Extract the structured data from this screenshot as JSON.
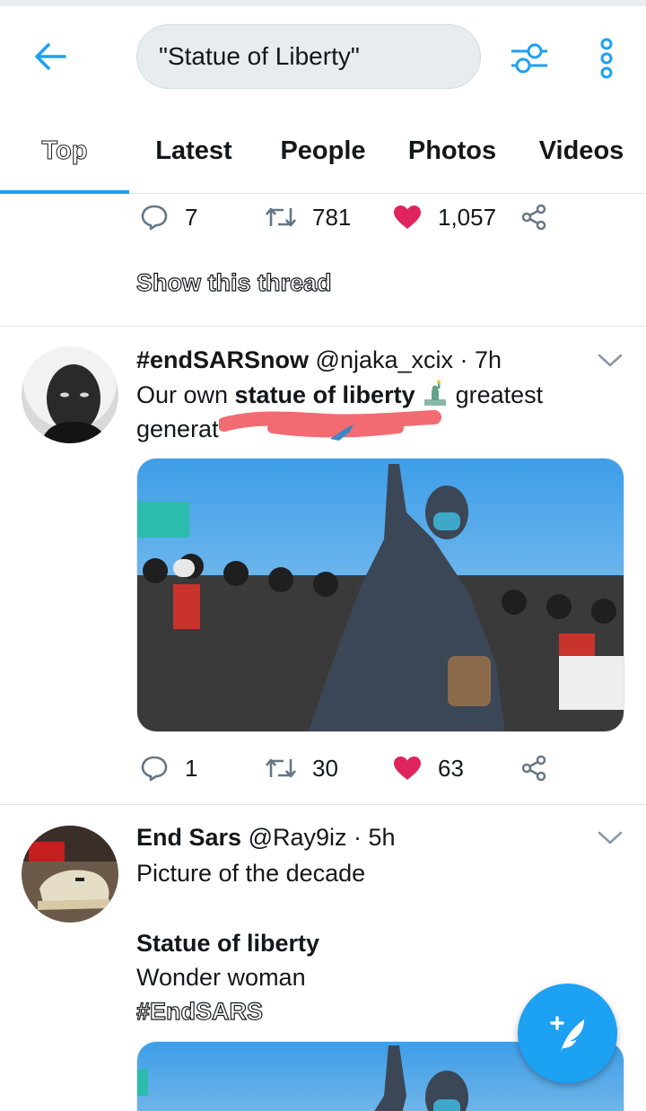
{
  "header": {
    "search_value": "\"Statue of Liberty\"",
    "back_icon": "arrow-left-icon",
    "filter_icon": "sliders-icon",
    "more_icon": "more-vertical-icon",
    "accent": "#1da1f2"
  },
  "tabs": [
    {
      "label": "Top"
    },
    {
      "label": "Latest"
    },
    {
      "label": "People"
    },
    {
      "label": "Photos"
    },
    {
      "label": "Videos"
    }
  ],
  "prev_tweet": {
    "replies": "7",
    "retweets": "781",
    "likes": "1,057",
    "show_thread": "Show this thread"
  },
  "tweet1": {
    "name": "#endSARSnow",
    "handle": "@njaka_xcix",
    "time": "· 7h",
    "text_plain": "Our own ",
    "text_bold": "statue of liberty",
    "text_after": " greatest",
    "text_line2": "generat",
    "replies": "1",
    "retweets": "30",
    "likes": "63"
  },
  "tweet2": {
    "name": "End Sars",
    "handle": "@Ray9iz",
    "time": "· 5h",
    "line1": "Picture of the decade",
    "line2": "Statue of liberty",
    "line3": "Wonder woman",
    "line4": "#EndSARS"
  },
  "colors": {
    "like": "#e0245e",
    "text": "#14171a",
    "muted": "#657786"
  }
}
